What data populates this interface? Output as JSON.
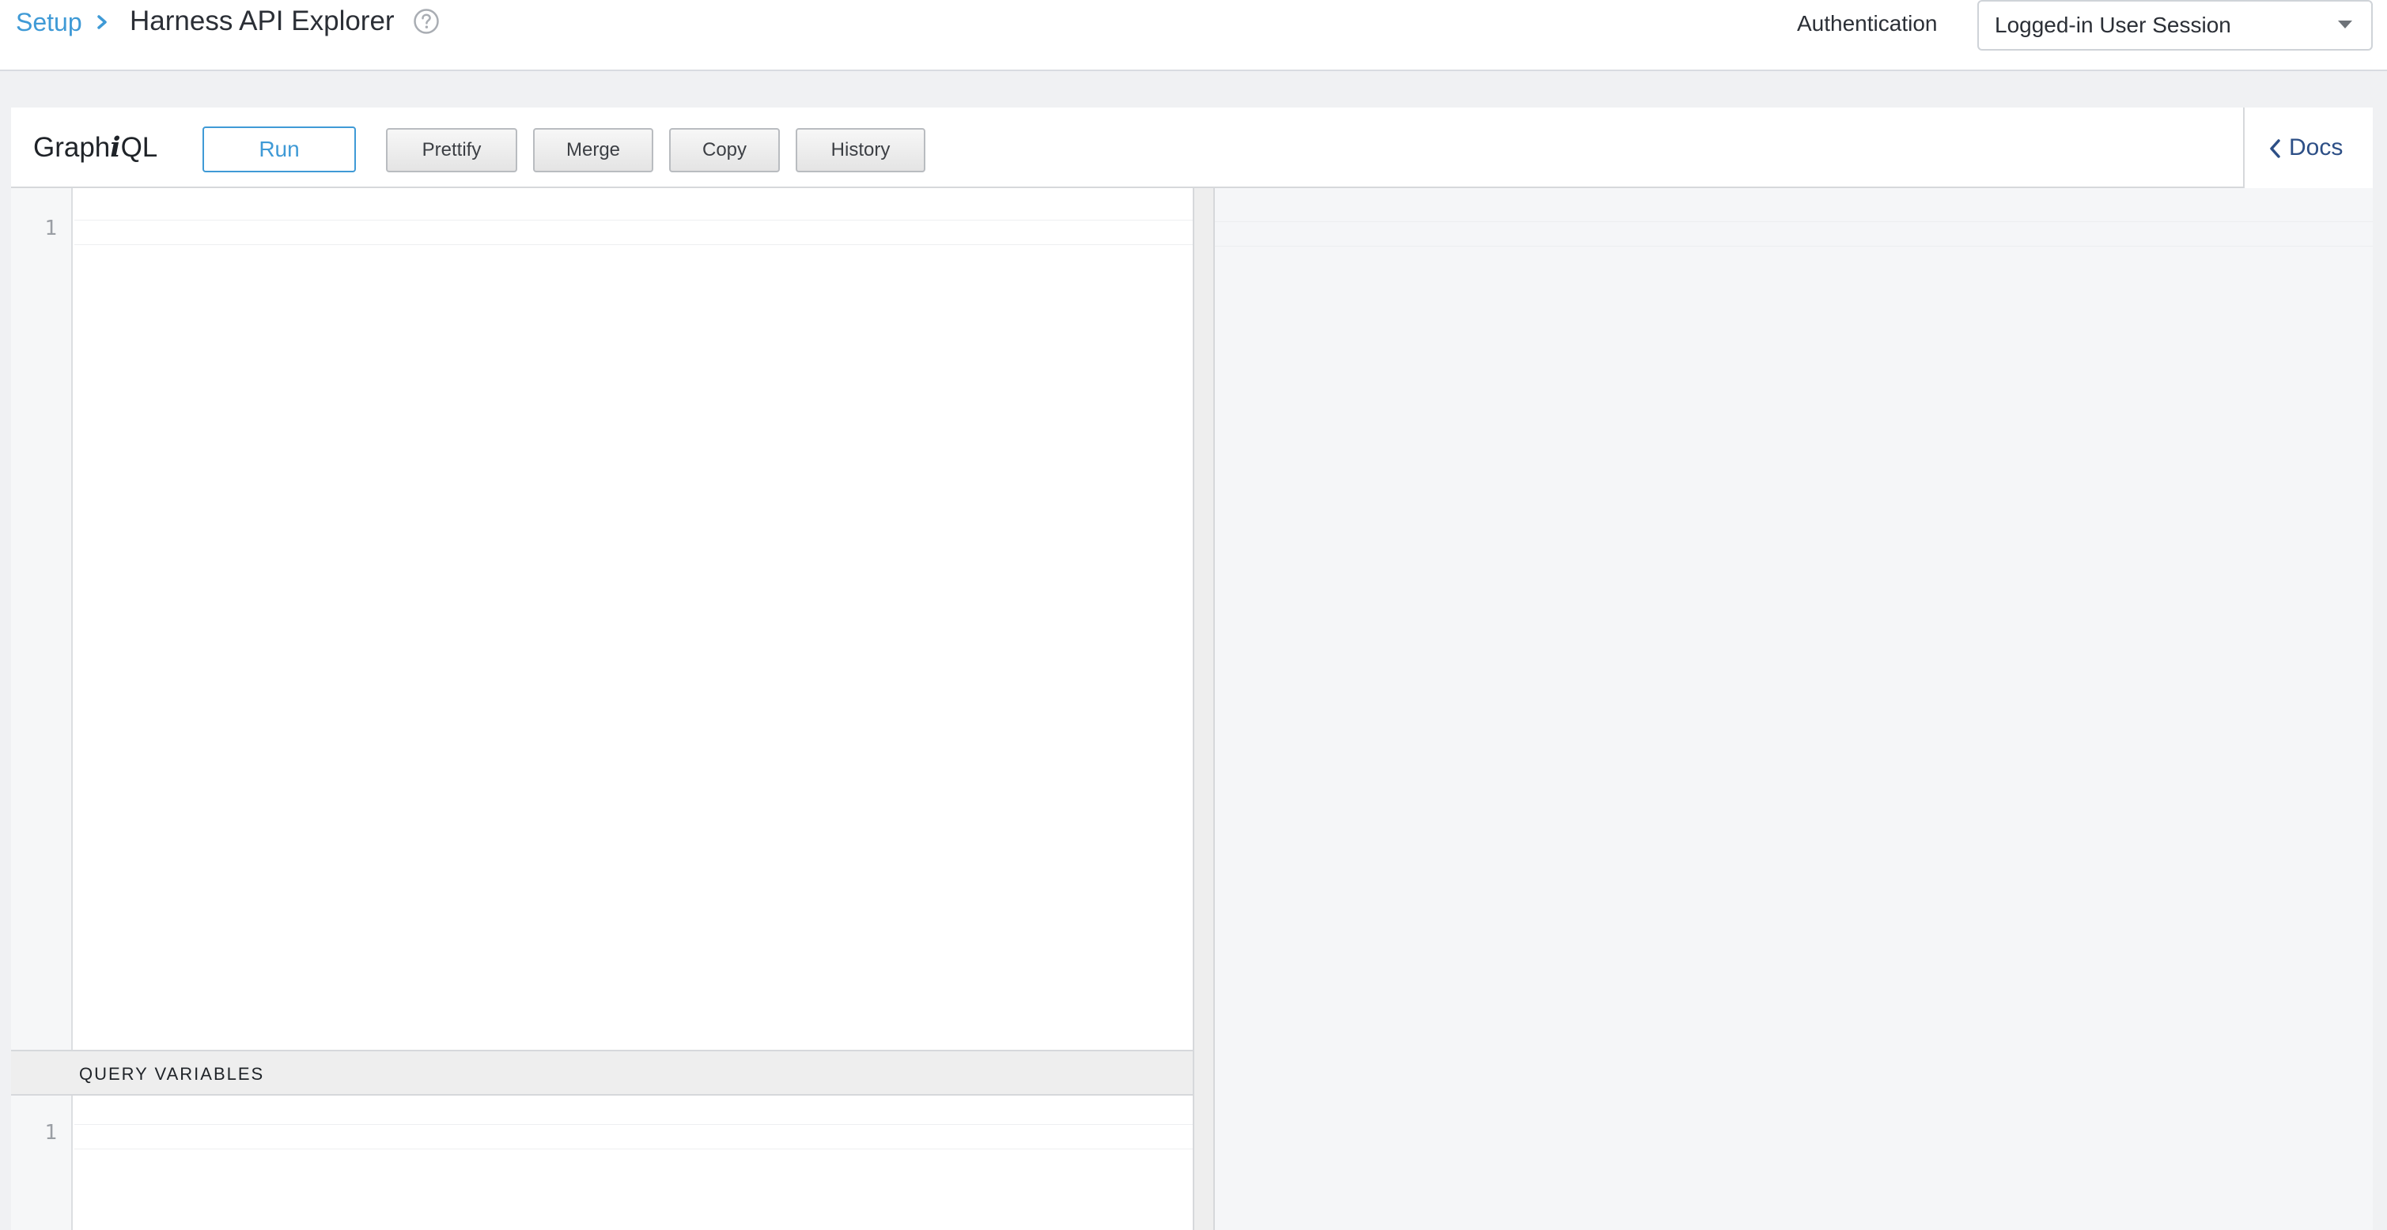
{
  "header": {
    "breadcrumb_root": "Setup",
    "title": "Harness API Explorer",
    "auth_label": "Authentication",
    "auth_value": "Logged-in User Session"
  },
  "graphiql": {
    "title_prefix": "Graph",
    "title_italic": "i",
    "title_suffix": "QL",
    "buttons": {
      "run": "Run",
      "prettify": "Prettify",
      "merge": "Merge",
      "copy": "Copy",
      "history": "History"
    },
    "docs_label": "Docs",
    "query_editor": {
      "line_numbers": [
        "1"
      ]
    },
    "variables": {
      "title": "QUERY VARIABLES",
      "line_numbers": [
        "1"
      ]
    }
  },
  "icons": {
    "breadcrumb_separator": "chevron-right-icon",
    "help": "question-circle-icon",
    "dropdown": "caret-down-icon",
    "docs": "chevron-left-icon"
  },
  "colors": {
    "accent": "#3f9ad6",
    "docs_link": "#2d4f86",
    "text": "#2b2f36"
  }
}
